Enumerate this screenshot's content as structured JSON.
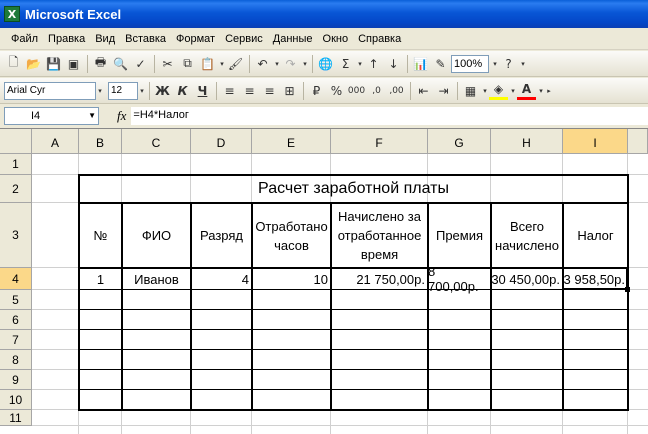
{
  "window": {
    "title": "Microsoft Excel",
    "app_icon_glyph": "X"
  },
  "menu": [
    {
      "label": "Файл"
    },
    {
      "label": "Правка"
    },
    {
      "label": "Вид"
    },
    {
      "label": "Вставка"
    },
    {
      "label": "Формат"
    },
    {
      "label": "Сервис"
    },
    {
      "label": "Данные"
    },
    {
      "label": "Окно"
    },
    {
      "label": "Справка"
    }
  ],
  "toolbar": {
    "zoom": "100%",
    "font_name": "Arial Cyr",
    "font_size": "12",
    "bold": "Ж",
    "italic": "К",
    "underline": "Ч",
    "percent": "%",
    "thousands": "000",
    "sigma": "Σ"
  },
  "formula_bar": {
    "cell_ref": "I4",
    "fx": "fx",
    "formula": "=H4*Налог"
  },
  "columns": [
    "A",
    "B",
    "C",
    "D",
    "E",
    "F",
    "G",
    "H",
    "I"
  ],
  "rows": [
    "1",
    "2",
    "3",
    "4",
    "5",
    "6",
    "7",
    "8",
    "9",
    "10",
    "11"
  ],
  "table": {
    "title": "Расчет заработной платы",
    "headers": [
      "№",
      "ФИО",
      "Разряд",
      "Отработано часов",
      "Начислено за отработанное время",
      "Премия",
      "Всего начислено",
      "Налог"
    ],
    "row4": [
      "1",
      "Иванов",
      "4",
      "10",
      "21 750,00р.",
      "8 700,00р.",
      "30 450,00р.",
      "3 958,50р."
    ]
  }
}
